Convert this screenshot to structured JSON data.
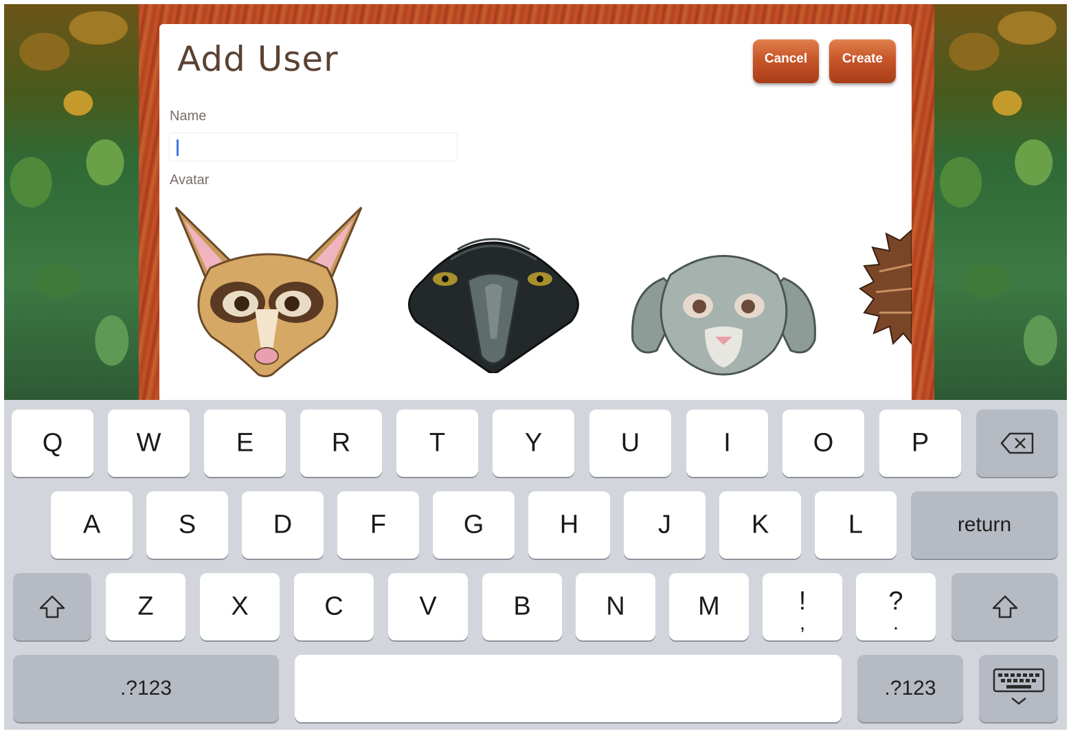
{
  "dialog": {
    "title": "Add User",
    "cancel_label": "Cancel",
    "create_label": "Create",
    "name_label": "Name",
    "name_value": "",
    "avatar_label": "Avatar",
    "avatars": [
      "bushbaby-avatar-icon",
      "eagle-avatar-icon",
      "bunny-avatar-icon",
      "echidna-avatar-icon"
    ]
  },
  "keyboard": {
    "row1": [
      "Q",
      "W",
      "E",
      "R",
      "T",
      "Y",
      "U",
      "I",
      "O",
      "P"
    ],
    "row2": [
      "A",
      "S",
      "D",
      "F",
      "G",
      "H",
      "J",
      "K",
      "L"
    ],
    "row3": [
      "Z",
      "X",
      "C",
      "V",
      "B",
      "N",
      "M"
    ],
    "return_label": "return",
    "exclaim_top": "!",
    "exclaim_bottom": ",",
    "question_top": "?",
    "question_bottom": ".",
    "numbers_label": ".?123",
    "icons": [
      "backspace-icon",
      "shift-icon",
      "hide-keyboard-icon"
    ]
  },
  "colors": {
    "button": "#c8562a",
    "title_text": "#5a4232",
    "keyboard_bg": "#d2d5db",
    "wood": "#b5421f"
  }
}
